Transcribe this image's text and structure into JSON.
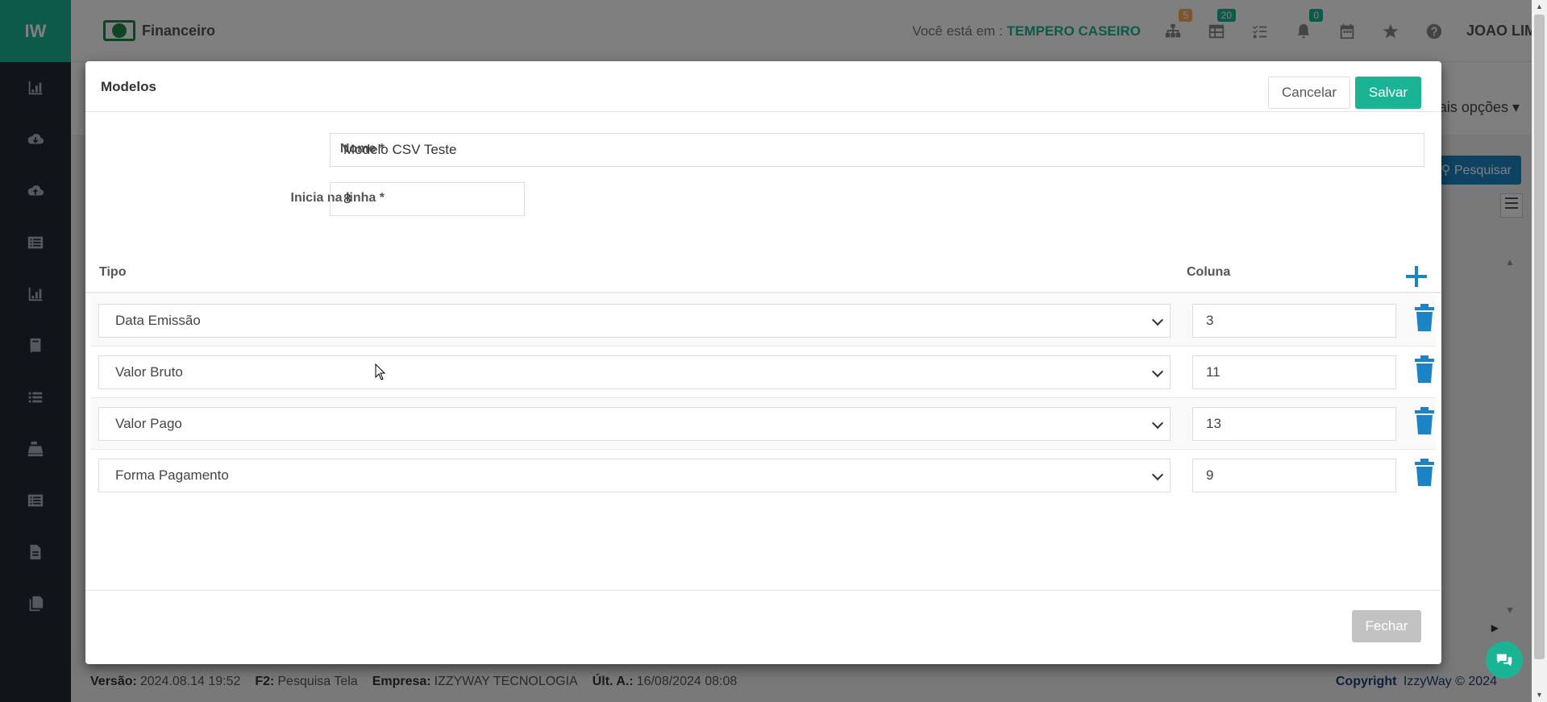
{
  "app": {
    "logo": "IW",
    "module_title": "Financeiro",
    "where_label": "Você está em :",
    "company": "TEMPERO CASEIRO",
    "badges": {
      "network": "5",
      "table": "20",
      "bell": "0"
    },
    "badge_colors": {
      "network": "#f8ac59",
      "table": "#1ab394",
      "bell": "#1ab394"
    },
    "user": "JOAO LIMA"
  },
  "background": {
    "more_options": "ais opções ▾",
    "search_button": "Pesquisar",
    "footer": {
      "version_label": "Versão:",
      "version": "2024.08.14 19:52",
      "f2_label": "F2:",
      "f2": "Pesquisa Tela",
      "company_label": "Empresa:",
      "company": "IZZYWAY TECNOLOGIA",
      "last_label": "Últ. A.:",
      "last": "16/08/2024 08:08",
      "copyright_label": "Copyright",
      "copyright": "IzzyWay © 2024"
    }
  },
  "modal": {
    "title": "Modelos",
    "cancel_label": "Cancelar",
    "save_label": "Salvar",
    "close_label": "Fechar",
    "fields": {
      "nome_label": "Nome *",
      "nome_value": "Modelo CSV Teste",
      "inicia_label": "Inicia na linha *",
      "inicia_value": "8"
    },
    "table": {
      "col_tipo": "Tipo",
      "col_coluna": "Coluna",
      "rows": [
        {
          "tipo": "Data Emissão",
          "coluna": "3"
        },
        {
          "tipo": "Valor Bruto",
          "coluna": "11"
        },
        {
          "tipo": "Valor Pago",
          "coluna": "13"
        },
        {
          "tipo": "Forma Pagamento",
          "coluna": "9"
        }
      ]
    }
  },
  "colors": {
    "accent": "#1ab394",
    "primary": "#1c84c6",
    "sidebar": "#1e2a33"
  }
}
